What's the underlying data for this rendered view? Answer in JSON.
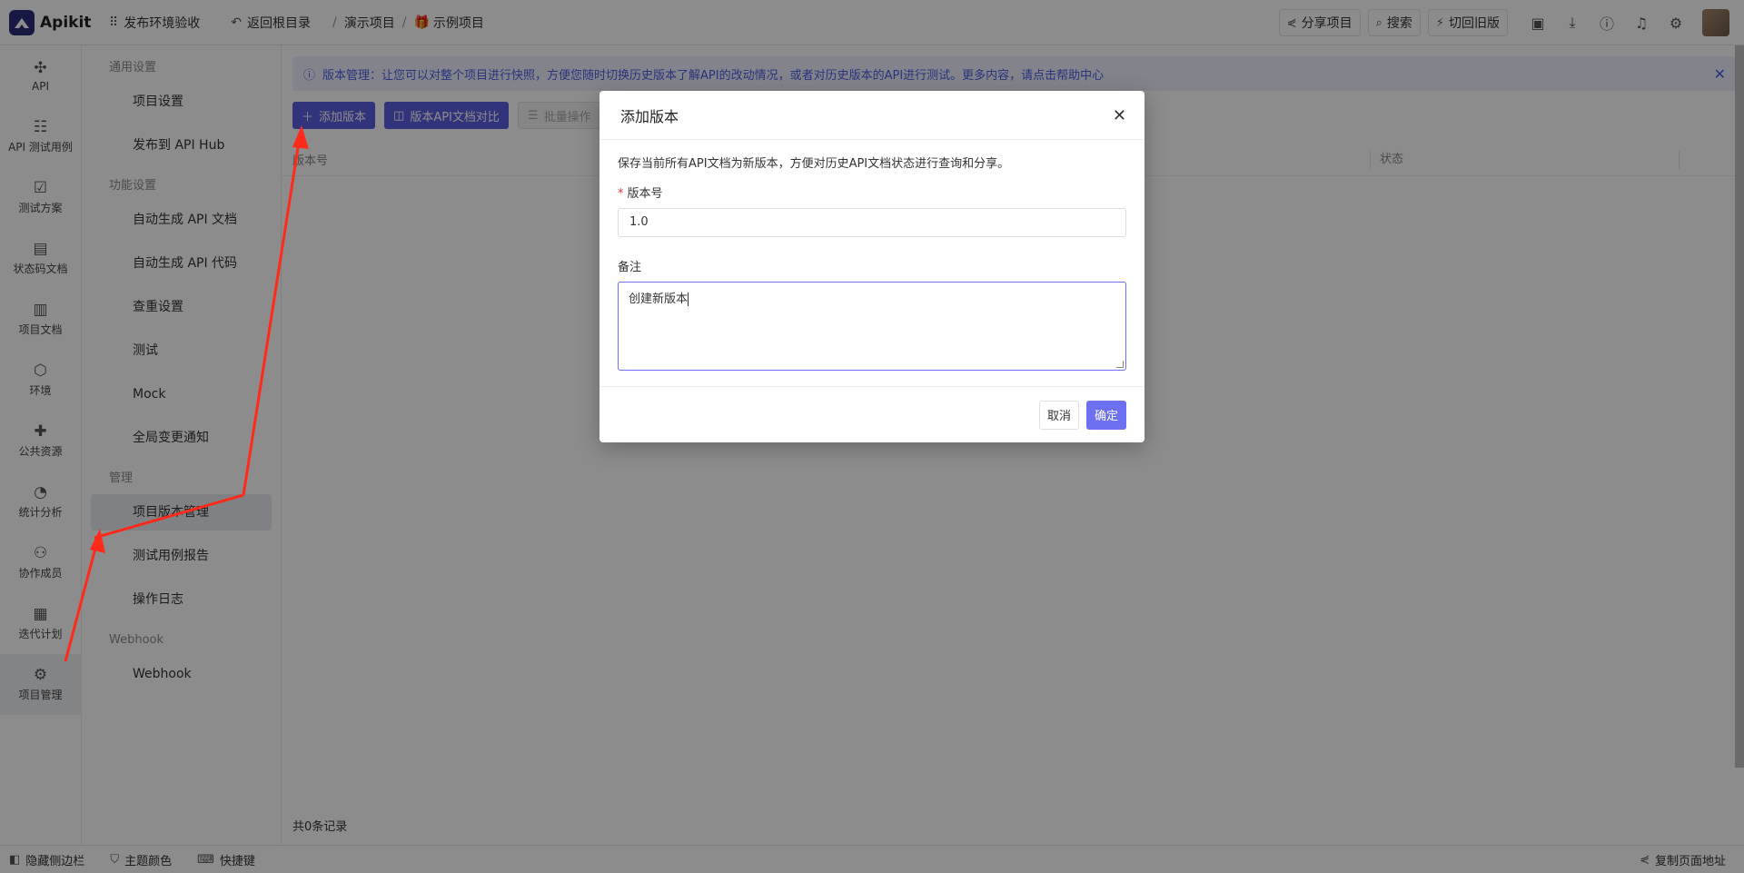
{
  "topbar": {
    "brand": "Apikit",
    "workspace": "发布环境验收",
    "back_label": "返回根目录",
    "breadcrumb": [
      "演示项目",
      "示例项目"
    ],
    "share_label": "分享项目",
    "search_label": "搜索",
    "switch_label": "切回旧版"
  },
  "leftnav": {
    "items": [
      {
        "label": "API",
        "icon": "api-icon"
      },
      {
        "label": "API 测试用例",
        "icon": "test-case-icon"
      },
      {
        "label": "测试方案",
        "icon": "test-plan-icon"
      },
      {
        "label": "状态码文档",
        "icon": "status-code-icon"
      },
      {
        "label": "项目文档",
        "icon": "doc-icon"
      },
      {
        "label": "环境",
        "icon": "environment-icon"
      },
      {
        "label": "公共资源",
        "icon": "puzzle-icon"
      },
      {
        "label": "统计分析",
        "icon": "pie-chart-icon"
      },
      {
        "label": "协作成员",
        "icon": "members-icon"
      },
      {
        "label": "迭代计划",
        "icon": "calendar-icon"
      },
      {
        "label": "项目管理",
        "icon": "gear-icon"
      }
    ]
  },
  "submenu": {
    "group_general": "通用设置",
    "general": [
      "项目设置",
      "发布到 API Hub"
    ],
    "group_features": "功能设置",
    "features": [
      "自动生成 API 文档",
      "自动生成 API 代码",
      "查重设置",
      "测试",
      "Mock",
      "全局变更通知"
    ],
    "group_manage": "管理",
    "manage": [
      "项目版本管理",
      "测试用例报告",
      "操作日志"
    ],
    "group_webhook": "Webhook",
    "webhook": [
      "Webhook"
    ]
  },
  "main": {
    "banner": "版本管理：让您可以对整个项目进行快照，方便您随时切换历史版本了解API的改动情况，或者对历史版本的API进行测试。更多内容，请点击帮助中心",
    "add_version": "添加版本",
    "compare": "版本API文档对比",
    "batch": "批量操作",
    "col_version": "版本号",
    "col_status": "状态",
    "total": "共0条记录"
  },
  "modal": {
    "title": "添加版本",
    "description": "保存当前所有API文档为新版本，方便对历史API文档状态进行查询和分享。",
    "version_label": "版本号",
    "version_value": "1.0",
    "note_label": "备注",
    "note_value": "创建新版本",
    "cancel": "取消",
    "confirm": "确定"
  },
  "bottombar": {
    "hide_sidebar": "隐藏侧边栏",
    "theme": "主题颜色",
    "shortcuts": "快捷键",
    "copy_url": "复制页面地址"
  },
  "colors": {
    "primary": "#5b5fe0",
    "banner_bg": "#eef1fd",
    "banner_text": "#4b5ee6",
    "arrow": "#ff2a1a"
  }
}
